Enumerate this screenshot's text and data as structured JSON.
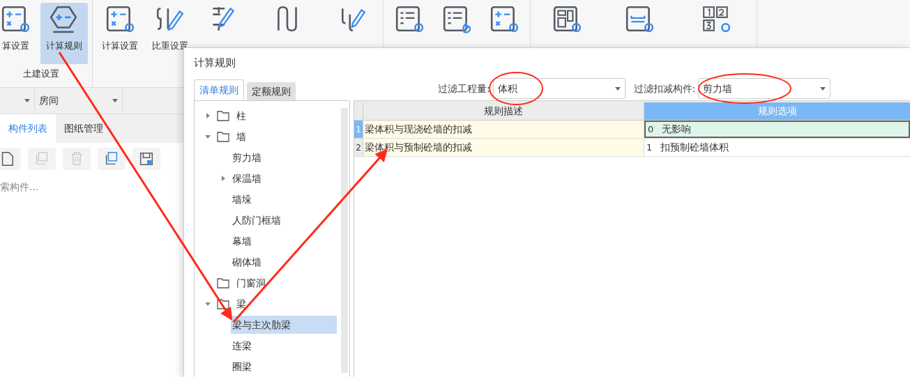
{
  "ribbon": {
    "groups": [
      {
        "label": "土建设置",
        "items": [
          {
            "label": "算设置",
            "selected": false
          },
          {
            "label": "计算规则",
            "selected": true
          }
        ]
      },
      {
        "items": [
          {
            "label": "计算设置",
            "selected": false
          },
          {
            "label": "比重设置",
            "selected": false
          },
          {
            "selected": false
          },
          {
            "selected": false
          },
          {
            "selected": false
          }
        ]
      },
      {
        "items": [
          {
            "selected": false
          },
          {
            "selected": false
          },
          {
            "selected": false
          }
        ]
      },
      {
        "items": [
          {
            "selected": false
          },
          {
            "selected": false
          },
          {
            "selected": false
          }
        ]
      }
    ]
  },
  "left_panel": {
    "selectors": [
      {
        "kind": "blank"
      },
      {
        "kind": "text",
        "value": "房间"
      }
    ],
    "tabs": [
      {
        "label": "构件列表",
        "selected": true
      },
      {
        "label": "图纸管理",
        "selected": false
      }
    ],
    "toolbar": [
      {
        "disabled": false
      },
      {
        "disabled": true
      },
      {
        "disabled": true
      },
      {
        "disabled": false
      },
      {
        "disabled": false
      }
    ],
    "search": {
      "placeholder": "索构件..."
    }
  },
  "dialog": {
    "title": "计算规则",
    "tabs": [
      {
        "label": "清单规则",
        "selected": true
      },
      {
        "label": "定额规则",
        "selected": false
      }
    ],
    "filters": [
      {
        "label": "过滤工程量:",
        "value": "体积"
      },
      {
        "label": "过滤扣减构件:",
        "value": "剪力墙"
      }
    ],
    "tree": [
      {
        "label": "柱",
        "kind": "folder",
        "expanded": false,
        "selected": false
      },
      {
        "label": "墙",
        "kind": "folder",
        "expanded": true,
        "selected": false,
        "children": [
          {
            "label": "剪力墙",
            "kind": "leaf",
            "selected": false
          },
          {
            "label": "保温墙",
            "kind": "branch",
            "expanded": false,
            "selected": false
          },
          {
            "label": "墙垛",
            "kind": "leaf",
            "selected": false
          },
          {
            "label": "人防门框墙",
            "kind": "leaf",
            "selected": false
          },
          {
            "label": "幕墙",
            "kind": "leaf",
            "selected": false
          },
          {
            "label": "砌体墙",
            "kind": "leaf",
            "selected": false
          }
        ]
      },
      {
        "label": "门窗洞",
        "kind": "empty-folder",
        "selected": false
      },
      {
        "label": "梁",
        "kind": "folder",
        "expanded": true,
        "selected": false,
        "children": [
          {
            "label": "梁与主次肋梁",
            "kind": "leaf",
            "selected": true
          },
          {
            "label": "连梁",
            "kind": "leaf",
            "selected": false
          },
          {
            "label": "圈梁",
            "kind": "leaf",
            "selected": false
          }
        ]
      }
    ],
    "table": {
      "columns": [
        "规则描述",
        "规则选项"
      ],
      "rows": [
        {
          "number": "1",
          "description": "梁体积与现浇砼墙的扣减",
          "option_code": "0",
          "option": "无影响",
          "selected": true
        },
        {
          "number": "2",
          "description": "梁体积与预制砼墙的扣减",
          "option_code": "1",
          "option": "扣预制砼墙体积",
          "selected": false
        }
      ]
    }
  }
}
